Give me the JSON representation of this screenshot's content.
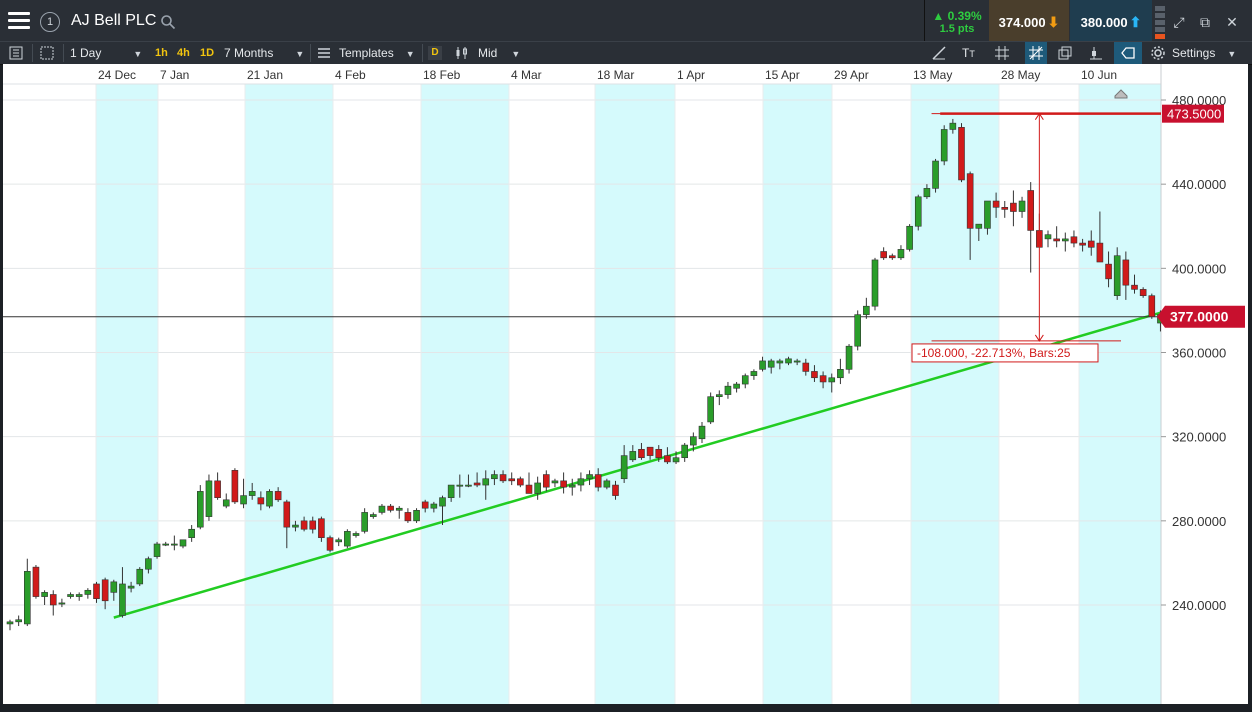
{
  "header": {
    "symbol_number": "1",
    "title": "AJ Bell PLC",
    "change_pct": "▲ 0.39%",
    "change_pts": "1.5 pts",
    "sell_price": "374.000",
    "buy_price": "380.000"
  },
  "toolbar": {
    "interval": "1 Day",
    "quick_1h": "1h",
    "quick_4h": "4h",
    "quick_1d": "1D",
    "range": "7 Months",
    "templates": "Templates",
    "price_type_badge": "D",
    "price_type": "Mid",
    "settings": "Settings"
  },
  "colors": {
    "up": "#2a9d2a",
    "down": "#d11a1a",
    "trendline": "#22cc22",
    "shade": "#d5fafc",
    "price_label_bg": "#c8102e"
  },
  "chart_data": {
    "type": "candlestick",
    "title": "AJ Bell PLC",
    "x_tick_labels": [
      "24 Dec",
      "7 Jan",
      "21 Jan",
      "4 Feb",
      "18 Feb",
      "4 Mar",
      "18 Mar",
      "1 Apr",
      "15 Apr",
      "29 Apr",
      "13 May",
      "28 May",
      "10 Jun"
    ],
    "y_tick_labels": [
      "480.0000",
      "440.0000",
      "400.0000",
      "360.0000",
      "320.0000",
      "280.0000",
      "240.0000"
    ],
    "y_ticks": [
      480,
      440,
      400,
      360,
      320,
      280,
      240
    ],
    "ylim": [
      209,
      491
    ],
    "current_price": 377.0,
    "current_price_label": "377.0000",
    "horizontal_level": 473.5,
    "horizontal_level_label": "473.5000",
    "measure_label": "-108.000, -22.713%, Bars:25",
    "measure_from": 473.5,
    "measure_to": 365.5,
    "trendline": {
      "from": {
        "date": "20 Dec",
        "price": 234
      },
      "to": {
        "date": "24 Jun",
        "price": 379
      }
    },
    "candles": [
      {
        "d": "4 Dec",
        "o": 231,
        "h": 233,
        "l": 228,
        "c": 232
      },
      {
        "d": "5 Dec",
        "o": 232,
        "h": 235,
        "l": 230,
        "c": 233
      },
      {
        "d": "6 Dec",
        "o": 231,
        "h": 262,
        "l": 230,
        "c": 256
      },
      {
        "d": "7 Dec",
        "o": 258,
        "h": 259,
        "l": 243,
        "c": 244
      },
      {
        "d": "10 Dec",
        "o": 244,
        "h": 247,
        "l": 240,
        "c": 246
      },
      {
        "d": "11 Dec",
        "o": 245,
        "h": 247,
        "l": 235,
        "c": 240
      },
      {
        "d": "12 Dec",
        "o": 241,
        "h": 243,
        "l": 239,
        "c": 241
      },
      {
        "d": "13 Dec",
        "o": 244,
        "h": 246,
        "l": 243,
        "c": 245
      },
      {
        "d": "14 Dec",
        "o": 244,
        "h": 246,
        "l": 242,
        "c": 245
      },
      {
        "d": "17 Dec",
        "o": 245,
        "h": 248,
        "l": 243,
        "c": 247
      },
      {
        "d": "18 Dec",
        "o": 250,
        "h": 251,
        "l": 241,
        "c": 243
      },
      {
        "d": "19 Dec",
        "o": 252,
        "h": 253,
        "l": 238,
        "c": 242
      },
      {
        "d": "20 Dec",
        "o": 246,
        "h": 252,
        "l": 242,
        "c": 251
      },
      {
        "d": "21 Dec",
        "o": 235,
        "h": 258,
        "l": 234,
        "c": 250
      },
      {
        "d": "24 Dec",
        "o": 248,
        "h": 251,
        "l": 246,
        "c": 249
      },
      {
        "d": "27 Dec",
        "o": 250,
        "h": 258,
        "l": 249,
        "c": 257
      },
      {
        "d": "28 Dec",
        "o": 257,
        "h": 263,
        "l": 255,
        "c": 262
      },
      {
        "d": "31 Dec",
        "o": 263,
        "h": 270,
        "l": 262,
        "c": 269
      },
      {
        "d": "2 Jan",
        "o": 269,
        "h": 270,
        "l": 268,
        "c": 269
      },
      {
        "d": "3 Jan",
        "o": 269,
        "h": 273,
        "l": 266,
        "c": 269
      },
      {
        "d": "4 Jan",
        "o": 268,
        "h": 270,
        "l": 267,
        "c": 271
      },
      {
        "d": "7 Jan",
        "o": 272,
        "h": 278,
        "l": 270,
        "c": 276
      },
      {
        "d": "8 Jan",
        "o": 277,
        "h": 297,
        "l": 276,
        "c": 294
      },
      {
        "d": "9 Jan",
        "o": 282,
        "h": 302,
        "l": 280,
        "c": 299
      },
      {
        "d": "10 Jan",
        "o": 299,
        "h": 303,
        "l": 290,
        "c": 291
      },
      {
        "d": "11 Jan",
        "o": 287,
        "h": 293,
        "l": 286,
        "c": 290
      },
      {
        "d": "14 Jan",
        "o": 304,
        "h": 305,
        "l": 288,
        "c": 289
      },
      {
        "d": "15 Jan",
        "o": 288,
        "h": 300,
        "l": 286,
        "c": 292
      },
      {
        "d": "16 Jan",
        "o": 292,
        "h": 298,
        "l": 290,
        "c": 294
      },
      {
        "d": "17 Jan",
        "o": 291,
        "h": 294,
        "l": 285,
        "c": 288
      },
      {
        "d": "18 Jan",
        "o": 287,
        "h": 295,
        "l": 286,
        "c": 294
      },
      {
        "d": "21 Jan",
        "o": 294,
        "h": 296,
        "l": 289,
        "c": 290
      },
      {
        "d": "22 Jan",
        "o": 289,
        "h": 290,
        "l": 267,
        "c": 277
      },
      {
        "d": "23 Jan",
        "o": 277,
        "h": 280,
        "l": 275,
        "c": 278
      },
      {
        "d": "24 Jan",
        "o": 280,
        "h": 282,
        "l": 275,
        "c": 276
      },
      {
        "d": "25 Jan",
        "o": 280,
        "h": 282,
        "l": 274,
        "c": 276
      },
      {
        "d": "28 Jan",
        "o": 281,
        "h": 282,
        "l": 270,
        "c": 272
      },
      {
        "d": "29 Jan",
        "o": 272,
        "h": 273,
        "l": 265,
        "c": 266
      },
      {
        "d": "30 Jan",
        "o": 270,
        "h": 272,
        "l": 268,
        "c": 271
      },
      {
        "d": "31 Jan",
        "o": 268,
        "h": 276,
        "l": 267,
        "c": 275
      },
      {
        "d": "1 Feb",
        "o": 273,
        "h": 275,
        "l": 272,
        "c": 274
      },
      {
        "d": "4 Feb",
        "o": 275,
        "h": 286,
        "l": 274,
        "c": 284
      },
      {
        "d": "5 Feb",
        "o": 282,
        "h": 284,
        "l": 281,
        "c": 283
      },
      {
        "d": "6 Feb",
        "o": 284,
        "h": 288,
        "l": 283,
        "c": 287
      },
      {
        "d": "7 Feb",
        "o": 287,
        "h": 288,
        "l": 284,
        "c": 285
      },
      {
        "d": "8 Feb",
        "o": 285,
        "h": 287,
        "l": 281,
        "c": 286
      },
      {
        "d": "11 Feb",
        "o": 284,
        "h": 286,
        "l": 279,
        "c": 280
      },
      {
        "d": "12 Feb",
        "o": 280,
        "h": 286,
        "l": 279,
        "c": 285
      },
      {
        "d": "13 Feb",
        "o": 289,
        "h": 290,
        "l": 284,
        "c": 286
      },
      {
        "d": "14 Feb",
        "o": 286,
        "h": 289,
        "l": 284,
        "c": 288
      },
      {
        "d": "15 Feb",
        "o": 287,
        "h": 292,
        "l": 278,
        "c": 291
      },
      {
        "d": "18 Feb",
        "o": 291,
        "h": 293,
        "l": 289,
        "c": 297
      },
      {
        "d": "19 Feb",
        "o": 297,
        "h": 302,
        "l": 291,
        "c": 297
      },
      {
        "d": "20 Feb",
        "o": 297,
        "h": 302,
        "l": 296,
        "c": 297
      },
      {
        "d": "21 Feb",
        "o": 298,
        "h": 303,
        "l": 296,
        "c": 297
      },
      {
        "d": "22 Feb",
        "o": 297,
        "h": 304,
        "l": 290,
        "c": 300
      },
      {
        "d": "25 Feb",
        "o": 300,
        "h": 304,
        "l": 297,
        "c": 302
      },
      {
        "d": "26 Feb",
        "o": 302,
        "h": 304,
        "l": 298,
        "c": 299
      },
      {
        "d": "27 Feb",
        "o": 300,
        "h": 303,
        "l": 297,
        "c": 299
      },
      {
        "d": "28 Feb",
        "o": 300,
        "h": 301,
        "l": 296,
        "c": 297
      },
      {
        "d": "1 Mar",
        "o": 297,
        "h": 303,
        "l": 293,
        "c": 293
      },
      {
        "d": "4 Mar",
        "o": 293,
        "h": 301,
        "l": 290,
        "c": 298
      },
      {
        "d": "5 Mar",
        "o": 302,
        "h": 304,
        "l": 294,
        "c": 296
      },
      {
        "d": "6 Mar",
        "o": 298,
        "h": 300,
        "l": 296,
        "c": 299
      },
      {
        "d": "7 Mar",
        "o": 299,
        "h": 303,
        "l": 293,
        "c": 296
      },
      {
        "d": "8 Mar",
        "o": 296,
        "h": 300,
        "l": 292,
        "c": 297
      },
      {
        "d": "11 Mar",
        "o": 297,
        "h": 303,
        "l": 294,
        "c": 300
      },
      {
        "d": "12 Mar",
        "o": 300,
        "h": 304,
        "l": 297,
        "c": 302
      },
      {
        "d": "13 Mar",
        "o": 302,
        "h": 305,
        "l": 294,
        "c": 296
      },
      {
        "d": "14 Mar",
        "o": 296,
        "h": 300,
        "l": 295,
        "c": 299
      },
      {
        "d": "15 Mar",
        "o": 297,
        "h": 299,
        "l": 290,
        "c": 292
      },
      {
        "d": "18 Mar",
        "o": 300,
        "h": 316,
        "l": 298,
        "c": 311
      },
      {
        "d": "19 Mar",
        "o": 309,
        "h": 316,
        "l": 308,
        "c": 313
      },
      {
        "d": "20 Mar",
        "o": 314,
        "h": 317,
        "l": 309,
        "c": 310
      },
      {
        "d": "21 Mar",
        "o": 315,
        "h": 315,
        "l": 309,
        "c": 311
      },
      {
        "d": "22 Mar",
        "o": 314,
        "h": 316,
        "l": 308,
        "c": 310
      },
      {
        "d": "25 Mar",
        "o": 311,
        "h": 315,
        "l": 307,
        "c": 308
      },
      {
        "d": "26 Mar",
        "o": 308,
        "h": 313,
        "l": 307,
        "c": 310
      },
      {
        "d": "27 Mar",
        "o": 310,
        "h": 317,
        "l": 308,
        "c": 316
      },
      {
        "d": "28 Mar",
        "o": 316,
        "h": 322,
        "l": 313,
        "c": 320
      },
      {
        "d": "29 Mar",
        "o": 319,
        "h": 327,
        "l": 317,
        "c": 325
      },
      {
        "d": "1 Apr",
        "o": 327,
        "h": 341,
        "l": 326,
        "c": 339
      },
      {
        "d": "2 Apr",
        "o": 339,
        "h": 342,
        "l": 335,
        "c": 340
      },
      {
        "d": "3 Apr",
        "o": 340,
        "h": 346,
        "l": 338,
        "c": 344
      },
      {
        "d": "4 Apr",
        "o": 343,
        "h": 346,
        "l": 341,
        "c": 345
      },
      {
        "d": "5 Apr",
        "o": 345,
        "h": 350,
        "l": 343,
        "c": 349
      },
      {
        "d": "8 Apr",
        "o": 349,
        "h": 352,
        "l": 347,
        "c": 351
      },
      {
        "d": "9 Apr",
        "o": 352,
        "h": 358,
        "l": 351,
        "c": 356
      },
      {
        "d": "10 Apr",
        "o": 353,
        "h": 357,
        "l": 350,
        "c": 356
      },
      {
        "d": "11 Apr",
        "o": 355,
        "h": 357,
        "l": 352,
        "c": 356
      },
      {
        "d": "12 Apr",
        "o": 355,
        "h": 358,
        "l": 354,
        "c": 357
      },
      {
        "d": "15 Apr",
        "o": 356,
        "h": 357,
        "l": 354,
        "c": 356
      },
      {
        "d": "16 Apr",
        "o": 355,
        "h": 357,
        "l": 349,
        "c": 351
      },
      {
        "d": "17 Apr",
        "o": 351,
        "h": 354,
        "l": 346,
        "c": 348
      },
      {
        "d": "18 Apr",
        "o": 349,
        "h": 351,
        "l": 343,
        "c": 346
      },
      {
        "d": "23 Apr",
        "o": 346,
        "h": 350,
        "l": 341,
        "c": 348
      },
      {
        "d": "24 Apr",
        "o": 348,
        "h": 357,
        "l": 345,
        "c": 352
      },
      {
        "d": "25 Apr",
        "o": 352,
        "h": 364,
        "l": 350,
        "c": 363
      },
      {
        "d": "26 Apr",
        "o": 363,
        "h": 380,
        "l": 361,
        "c": 378
      },
      {
        "d": "29 Apr",
        "o": 378,
        "h": 386,
        "l": 376,
        "c": 382
      },
      {
        "d": "30 Apr",
        "o": 382,
        "h": 405,
        "l": 380,
        "c": 404
      },
      {
        "d": "1 May",
        "o": 408,
        "h": 410,
        "l": 404,
        "c": 405
      },
      {
        "d": "2 May",
        "o": 406,
        "h": 407,
        "l": 404,
        "c": 405
      },
      {
        "d": "3 May",
        "o": 405,
        "h": 411,
        "l": 404,
        "c": 409
      },
      {
        "d": "7 May",
        "o": 409,
        "h": 421,
        "l": 408,
        "c": 420
      },
      {
        "d": "8 May",
        "o": 420,
        "h": 435,
        "l": 418,
        "c": 434
      },
      {
        "d": "9 May",
        "o": 434,
        "h": 440,
        "l": 433,
        "c": 438
      },
      {
        "d": "10 May",
        "o": 438,
        "h": 452,
        "l": 436,
        "c": 451
      },
      {
        "d": "13 May",
        "o": 451,
        "h": 468,
        "l": 449,
        "c": 466
      },
      {
        "d": "14 May",
        "o": 466,
        "h": 471,
        "l": 464,
        "c": 469
      },
      {
        "d": "15 May",
        "o": 467,
        "h": 469,
        "l": 441,
        "c": 442
      },
      {
        "d": "16 May",
        "o": 445,
        "h": 446,
        "l": 404,
        "c": 419
      },
      {
        "d": "17 May",
        "o": 419,
        "h": 421,
        "l": 413,
        "c": 421
      },
      {
        "d": "20 May",
        "o": 419,
        "h": 432,
        "l": 416,
        "c": 432
      },
      {
        "d": "21 May",
        "o": 432,
        "h": 436,
        "l": 424,
        "c": 429
      },
      {
        "d": "22 May",
        "o": 429,
        "h": 432,
        "l": 424,
        "c": 428
      },
      {
        "d": "23 May",
        "o": 431,
        "h": 437,
        "l": 420,
        "c": 427
      },
      {
        "d": "24 May",
        "o": 427,
        "h": 434,
        "l": 424,
        "c": 432
      },
      {
        "d": "28 May",
        "o": 437,
        "h": 441,
        "l": 398,
        "c": 418
      },
      {
        "d": "29 May",
        "o": 418,
        "h": 426,
        "l": 410,
        "c": 410
      },
      {
        "d": "30 May",
        "o": 414,
        "h": 418,
        "l": 410,
        "c": 416
      },
      {
        "d": "31 May",
        "o": 414,
        "h": 420,
        "l": 410,
        "c": 413
      },
      {
        "d": "3 Jun",
        "o": 413,
        "h": 417,
        "l": 408,
        "c": 414
      },
      {
        "d": "4 Jun",
        "o": 415,
        "h": 418,
        "l": 410,
        "c": 412
      },
      {
        "d": "5 Jun",
        "o": 412,
        "h": 414,
        "l": 408,
        "c": 411
      },
      {
        "d": "6 Jun",
        "o": 413,
        "h": 418,
        "l": 406,
        "c": 410
      },
      {
        "d": "7 Jun",
        "o": 412,
        "h": 427,
        "l": 404,
        "c": 403
      },
      {
        "d": "10 Jun",
        "o": 402,
        "h": 408,
        "l": 391,
        "c": 395
      },
      {
        "d": "11 Jun",
        "o": 387,
        "h": 410,
        "l": 385,
        "c": 406
      },
      {
        "d": "12 Jun",
        "o": 404,
        "h": 408,
        "l": 385,
        "c": 392
      },
      {
        "d": "13 Jun",
        "o": 392,
        "h": 397,
        "l": 388,
        "c": 390
      },
      {
        "d": "14 Jun",
        "o": 390,
        "h": 391,
        "l": 386,
        "c": 387
      },
      {
        "d": "17 Jun",
        "o": 387,
        "h": 388,
        "l": 376,
        "c": 377
      },
      {
        "d": "18 Jun",
        "o": 374,
        "h": 380,
        "l": 370,
        "c": 378
      }
    ]
  }
}
